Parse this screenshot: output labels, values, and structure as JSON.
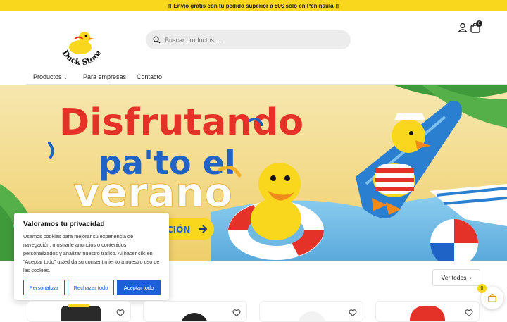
{
  "announcement": {
    "text": "Envío gratis con tu pedido superior a 50€ sólo en Península",
    "icon": "truck-icon"
  },
  "logo": {
    "brand_top": "duckstore",
    "brand_bottom": "Duck Store",
    "icon": "rubber-duck-logo"
  },
  "search": {
    "placeholder": "Buscar productos ..."
  },
  "header": {
    "cart_count": "0"
  },
  "nav": {
    "items": [
      {
        "label": "Productos"
      },
      {
        "label": "Para empresas"
      },
      {
        "label": "Contacto"
      }
    ]
  },
  "hero": {
    "line1": "Disfrutando",
    "line2": "pa'to el",
    "line3": "verano",
    "cta": "CCIÓN",
    "colors": {
      "red": "#e53229",
      "blue": "#1f63c6",
      "yellow": "#f8d71c",
      "sky": "#7fc1e8"
    }
  },
  "cookie": {
    "title": "Valoramos tu privacidad",
    "body": "Usamos cookies para mejorar su experiencia de navegación, mostrarle anuncios o contenidos personalizados y analizar nuestro tráfico. Al hacer clic en “Aceptar todo” usted da su consentimiento a nuestro uso de las cookies.",
    "btn_customize": "Personalizar",
    "btn_reject": "Rechazar todo",
    "btn_accept": "Aceptar todo",
    "accent": "#1c5fd6"
  },
  "section": {
    "view_all": "Ver todos"
  },
  "floating_cart": {
    "count": "0"
  }
}
